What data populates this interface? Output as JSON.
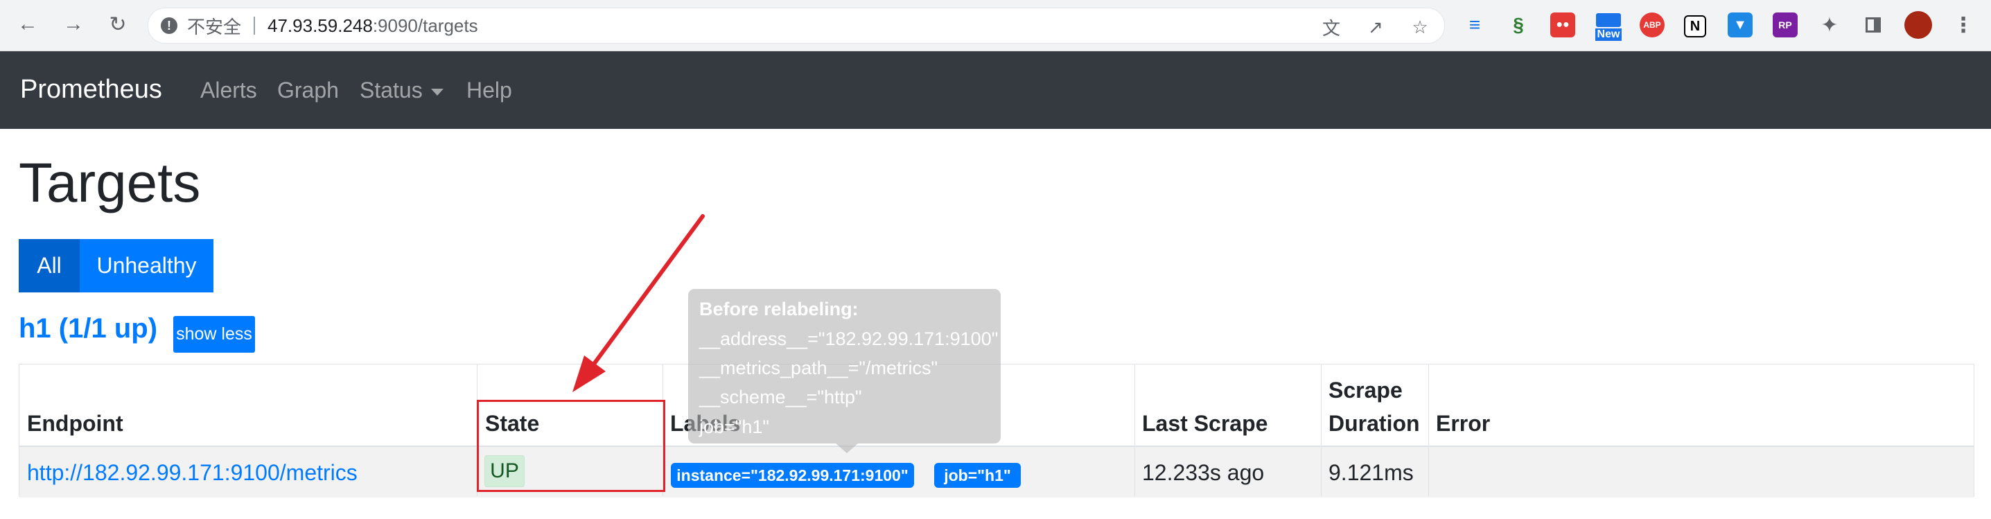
{
  "browser": {
    "url_insecure_label": "不安全",
    "url_host": "47.93.59.248",
    "url_port_path": ":9090/targets",
    "new_badge": "New",
    "abp": "ABP",
    "notion": "N",
    "rp": "RP"
  },
  "navbar": {
    "brand": "Prometheus",
    "links": [
      "Alerts",
      "Graph",
      "Status",
      "Help"
    ]
  },
  "page": {
    "title": "Targets",
    "filters": {
      "all": "All",
      "unhealthy": "Unhealthy"
    }
  },
  "job": {
    "title": "h1 (1/1 up)",
    "toggle": "show less",
    "columns": [
      "Endpoint",
      "State",
      "Labels",
      "Last Scrape",
      "Scrape",
      "Duration",
      "Error"
    ],
    "row": {
      "endpoint": "http://182.92.99.171:9100/metrics",
      "state": "UP",
      "labels": [
        "instance=\"182.92.99.171:9100\"",
        "job=\"h1\""
      ],
      "last_scrape": "12.233s ago",
      "scrape_duration": "9.121ms",
      "error": ""
    }
  },
  "tooltip": {
    "heading": "Before relabeling:",
    "lines": [
      "__address__=\"182.92.99.171:9100\"",
      "__metrics_path__=\"/metrics\"",
      "__scheme__=\"http\"",
      "job=\"h1\""
    ]
  },
  "colors": {
    "navbar": "#343a40",
    "primary": "#007bff",
    "up_badge": "#d4edda",
    "annotation": "#e0242c"
  }
}
